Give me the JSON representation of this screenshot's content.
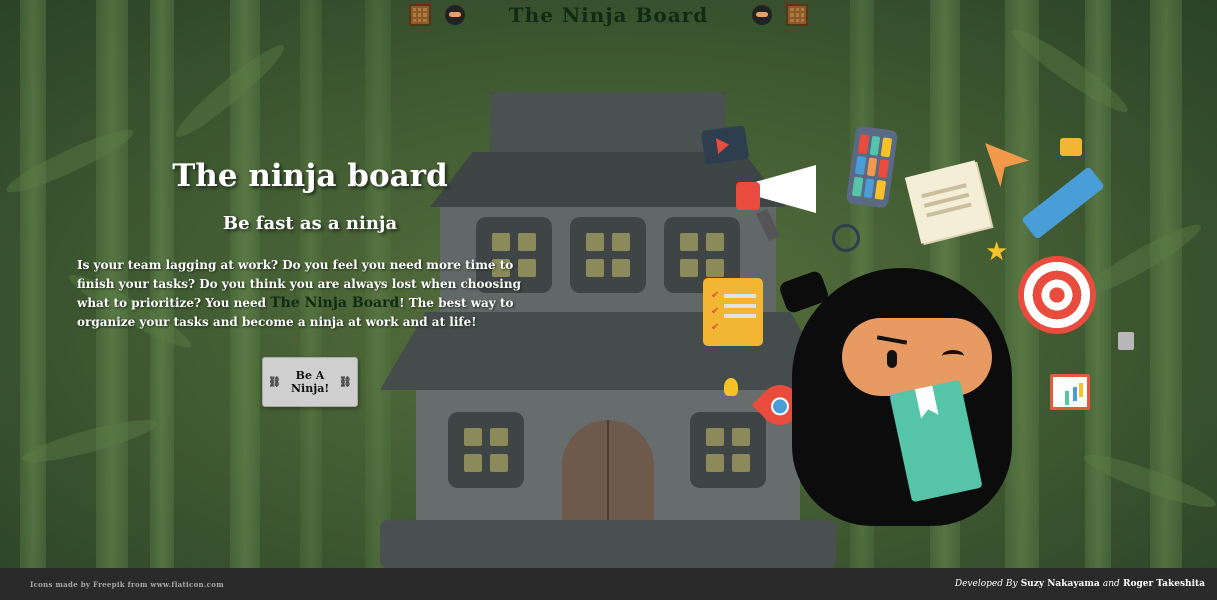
{
  "nav": {
    "title": "The Ninja Board"
  },
  "hero": {
    "title": "The ninja board",
    "subtitle": "Be fast as a ninja",
    "paragraph_before": "Is your team lagging at work? Do you feel you need more time to finish your tasks? Do you think you are always lost when choosing what to prioritize? You need ",
    "paragraph_brand": "The Ninja Board",
    "paragraph_after": "! The best way to organize your tasks and become a ninja at work and at life!",
    "cta_label": "Be A Ninja!"
  },
  "footer": {
    "left_credit": "Icons made by Freepik from www.flaticon.com",
    "developed_by": "Developed By",
    "developers": "Suzy Nakayama",
    "and": "and",
    "developer2": "Roger Takeshita"
  },
  "icons": [
    "crate-icon",
    "ninja-head-icon",
    "megaphone-icon",
    "phone-icon",
    "notes-icon",
    "paper-plane-icon",
    "pencil-icon",
    "star-icon",
    "target-icon",
    "clipboard-icon",
    "lightbulb-icon",
    "rocket-icon",
    "presentation-board-icon",
    "calculator-icon",
    "folder-icon",
    "video-book-icon",
    "gauge-icon"
  ],
  "colors": {
    "accent_dark": "#0f2b12",
    "footer_bg": "#2a2a2a",
    "button_bg": "#cfcfcf"
  }
}
